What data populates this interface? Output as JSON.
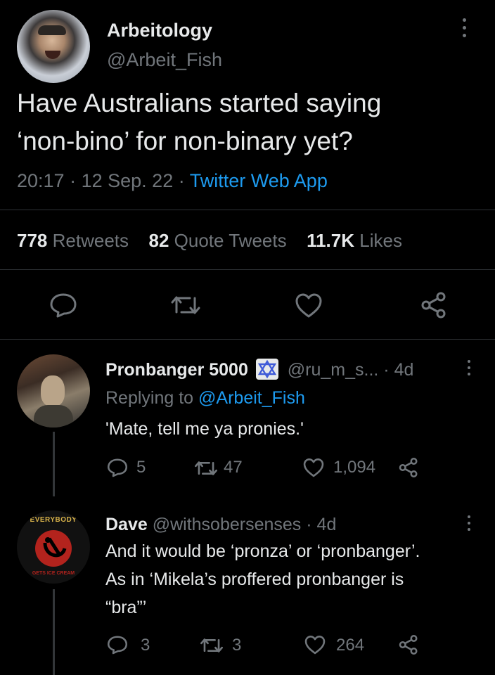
{
  "main_tweet": {
    "display_name": "Arbeitology",
    "handle": "@Arbeit_Fish",
    "text_line1": "Have Australians started saying",
    "text_line2": "‘non-bino’ for non-binary yet?",
    "time": "20:17",
    "date": "12 Sep. 22",
    "source": "Twitter Web App",
    "retweets_count": "778",
    "retweets_label": "Retweets",
    "quotes_count": "82",
    "quotes_label": "Quote Tweets",
    "likes_count": "11.7K",
    "likes_label": "Likes"
  },
  "replies": [
    {
      "display_name": "Pronbanger 5000",
      "handle": "@ru_m_s...",
      "age": "4d",
      "replying_to_prefix": "Replying to",
      "replying_to_handle": "@Arbeit_Fish",
      "text": "'Mate, tell me ya pronies.'",
      "reply_count": "5",
      "retweet_count": "47",
      "like_count": "1,094"
    },
    {
      "display_name": "Dave",
      "handle": "@withsobersenses",
      "age": "4d",
      "text_line1": "And it would be ‘pronza’ or ‘pronbanger’.",
      "text_line2": "As in ‘Mikela’s proffered pronbanger is",
      "text_line3": "“bra”’",
      "avatar_text_top": "EVERYBODY",
      "avatar_text_bottom": "GETS ICE CREAM",
      "reply_count": "3",
      "retweet_count": "3",
      "like_count": "264"
    }
  ],
  "colors": {
    "background": "#000000",
    "text": "#e7e9ea",
    "muted": "#71767b",
    "link": "#1d9bf0",
    "divider": "#2f3336"
  }
}
